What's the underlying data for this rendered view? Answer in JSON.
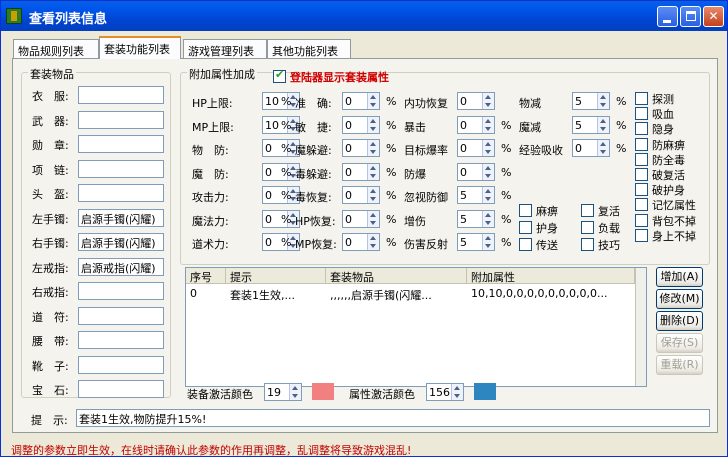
{
  "window": {
    "title": "查看列表信息"
  },
  "tabs": [
    "物品规则列表",
    "套装功能列表",
    "游戏管理列表",
    "其他功能列表"
  ],
  "suit_items": {
    "legend": "套装物品",
    "slots": [
      {
        "label": "衣　服:",
        "value": ""
      },
      {
        "label": "武　器:",
        "value": ""
      },
      {
        "label": "勋　章:",
        "value": ""
      },
      {
        "label": "项　链:",
        "value": ""
      },
      {
        "label": "头　盔:",
        "value": ""
      },
      {
        "label": "左手镯:",
        "value": "启源手镯(闪耀)"
      },
      {
        "label": "右手镯:",
        "value": "启源手镯(闪耀)"
      },
      {
        "label": "左戒指:",
        "value": "启源戒指(闪耀)"
      },
      {
        "label": "右戒指:",
        "value": ""
      },
      {
        "label": "道　符:",
        "value": ""
      },
      {
        "label": "腰　带:",
        "value": ""
      },
      {
        "label": "靴　子:",
        "value": ""
      },
      {
        "label": "宝　石:",
        "value": ""
      }
    ]
  },
  "attributes": {
    "legend": "附加属性加成",
    "show_suit_attr": {
      "label": "登陆器显示套装属性",
      "checked": true
    },
    "pct": "%",
    "col1": [
      {
        "label": "HP上限:",
        "value": "10"
      },
      {
        "label": "MP上限:",
        "value": "10"
      },
      {
        "label": "物　防:",
        "value": "0"
      },
      {
        "label": "魔　防:",
        "value": "0"
      },
      {
        "label": "攻击力:",
        "value": "0"
      },
      {
        "label": "魔法力:",
        "value": "0"
      },
      {
        "label": "道术力:",
        "value": "0"
      }
    ],
    "col2": [
      {
        "label": "准　确:",
        "value": "0"
      },
      {
        "label": "敏　捷:",
        "value": "0"
      },
      {
        "label": "魔躲避:",
        "value": "0"
      },
      {
        "label": "毒躲避:",
        "value": "0"
      },
      {
        "label": "毒恢复:",
        "value": "0"
      },
      {
        "label": "HP恢复:",
        "value": "0"
      },
      {
        "label": "MP恢复:",
        "value": "0"
      }
    ],
    "col3": [
      {
        "label": "内功恢复",
        "value": "0",
        "pct": false
      },
      {
        "label": "暴击",
        "value": "0",
        "pct": true
      },
      {
        "label": "目标爆率",
        "value": "0",
        "pct": true
      },
      {
        "label": "防爆",
        "value": "0",
        "pct": true
      },
      {
        "label": "忽视防御",
        "value": "5",
        "pct": true
      },
      {
        "label": "增伤",
        "value": "5",
        "pct": true
      },
      {
        "label": "伤害反射",
        "value": "5",
        "pct": true
      }
    ],
    "col4": [
      {
        "label": "物减",
        "value": "5"
      },
      {
        "label": "魔减",
        "value": "5"
      },
      {
        "label": "经验吸收",
        "value": "0"
      }
    ],
    "checks_a": [
      "麻痹",
      "护身",
      "传送"
    ],
    "checks_b": [
      "复活",
      "负载",
      "技巧"
    ],
    "checks_c": [
      "探测",
      "吸血",
      "隐身",
      "防麻痹",
      "防全毒",
      "破复活",
      "破护身",
      "记忆属性",
      "背包不掉",
      "身上不掉"
    ]
  },
  "table": {
    "columns": [
      "序号",
      "提示",
      "套装物品",
      "附加属性"
    ],
    "rows": [
      [
        "0",
        "套装1生效,...",
        ",,,,,,启源手镯(闪耀...",
        "10,10,0,0,0,0,0,0,0,0,0..."
      ]
    ]
  },
  "buttons": {
    "add": "增加(A)",
    "modify": "修改(M)",
    "delete": "删除(D)",
    "save": "保存(S)",
    "reload": "重载(R)"
  },
  "colors": {
    "equip_label": "装备激活颜色",
    "equip_value": "19",
    "equip_color": "#f28080",
    "attr_label": "属性激活颜色",
    "attr_value": "156",
    "attr_color": "#2e86c1"
  },
  "hint": {
    "label": "提　示:",
    "value": "套装1生效,物防提升15%!"
  },
  "status": "调整的参数立即生效，在线时请确认此参数的作用再调整，乱调整将导致游戏混乱!"
}
